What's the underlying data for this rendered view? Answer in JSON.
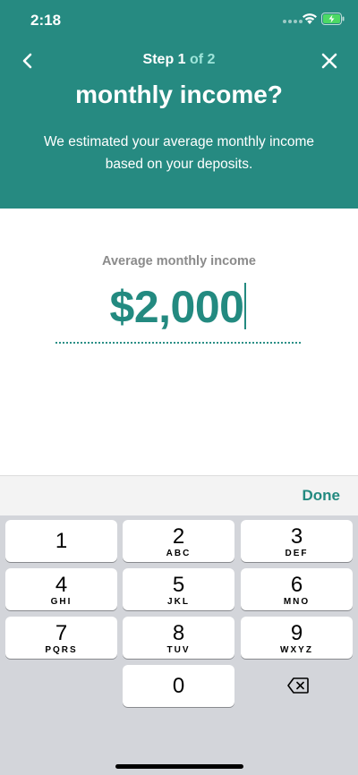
{
  "status_bar": {
    "time": "2:18"
  },
  "header": {
    "step_prefix": "Step 1",
    "step_suffix": " of 2",
    "title": "monthly income?",
    "subtitle": "We estimated your average monthly income based on your deposits."
  },
  "amount": {
    "label": "Average monthly income",
    "value": "$2,000"
  },
  "accessory": {
    "done_label": "Done"
  },
  "keypad": {
    "keys": [
      {
        "digit": "1",
        "letters": ""
      },
      {
        "digit": "2",
        "letters": "ABC"
      },
      {
        "digit": "3",
        "letters": "DEF"
      },
      {
        "digit": "4",
        "letters": "GHI"
      },
      {
        "digit": "5",
        "letters": "JKL"
      },
      {
        "digit": "6",
        "letters": "MNO"
      },
      {
        "digit": "7",
        "letters": "PQRS"
      },
      {
        "digit": "8",
        "letters": "TUV"
      },
      {
        "digit": "9",
        "letters": "WXYZ"
      },
      {
        "digit": "0",
        "letters": ""
      }
    ],
    "delete_icon": "backspace-icon"
  },
  "colors": {
    "header_bg": "#268a81",
    "accent": "#238a80",
    "keyboard_bg": "#d3d5da"
  }
}
